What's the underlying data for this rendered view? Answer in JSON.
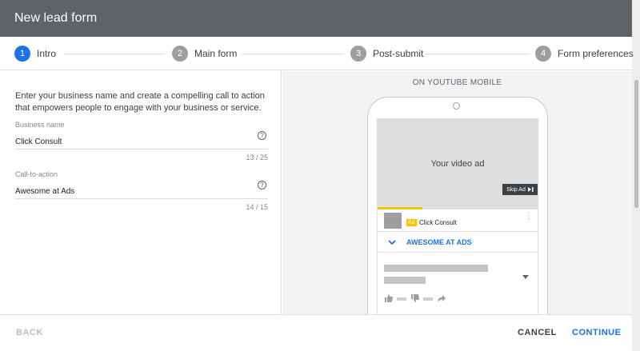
{
  "dialog": {
    "title": "New lead form"
  },
  "steps": [
    {
      "number": "1",
      "label": "Intro",
      "active": true
    },
    {
      "number": "2",
      "label": "Main form",
      "active": false
    },
    {
      "number": "3",
      "label": "Post-submit",
      "active": false
    },
    {
      "number": "4",
      "label": "Form preferences",
      "active": false
    }
  ],
  "intro": {
    "description": "Enter your business name and create a compelling call to action that empowers people to engage with your business or service."
  },
  "fields": {
    "business_name": {
      "label": "Business name",
      "value": "Click Consult",
      "count": "13 / 25"
    },
    "call_to_action": {
      "label": "Call-to-action",
      "value": "Awesome at Ads",
      "count": "14 / 15"
    }
  },
  "preview": {
    "label": "ON YOUTUBE MOBILE",
    "video_text": "Your video ad",
    "skip_label": "Skip Ad",
    "ad_badge": "Ad",
    "channel_name": "Click Consult",
    "cta_label": "AWESOME AT ADS",
    "video_progress": 0.28
  },
  "footer": {
    "back_label": "BACK",
    "cancel_label": "CANCEL",
    "continue_label": "CONTINUE"
  },
  "colors": {
    "accent": "#1a73e8",
    "header": "#5f6368",
    "ad_yellow": "#f4c20d"
  },
  "icons": {
    "help": "help-circle-icon",
    "skip": "skip-next-icon",
    "more": "more-vert-icon",
    "chevron": "chevron-down-icon",
    "like": "thumb-up-icon",
    "dislike": "thumb-down-icon",
    "share": "share-icon"
  }
}
